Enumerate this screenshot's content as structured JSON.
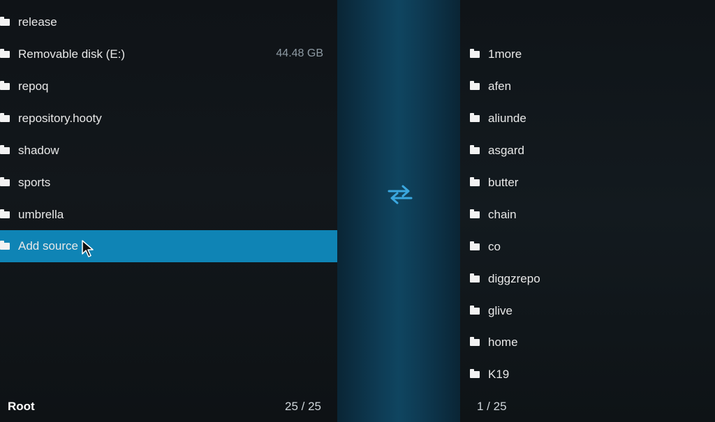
{
  "left_list": {
    "items": [
      {
        "label": "release"
      },
      {
        "label": "Removable disk (E:)",
        "size": "44.48 GB"
      },
      {
        "label": "repoq"
      },
      {
        "label": "repository.hooty"
      },
      {
        "label": "shadow"
      },
      {
        "label": "sports"
      },
      {
        "label": "umbrella"
      },
      {
        "label": "Add source",
        "selected": true
      }
    ]
  },
  "right_list": {
    "items": [
      {
        "label": "1more"
      },
      {
        "label": "afen"
      },
      {
        "label": "aliunde"
      },
      {
        "label": "asgard"
      },
      {
        "label": "butter"
      },
      {
        "label": "chain"
      },
      {
        "label": "co"
      },
      {
        "label": "diggzrepo"
      },
      {
        "label": "glive"
      },
      {
        "label": "home"
      },
      {
        "label": "K19"
      }
    ]
  },
  "footer": {
    "title": "Root",
    "left_count": "25 / 25",
    "right_count": "1 / 25"
  },
  "icons": {
    "folder": "folder-icon",
    "swap": "swap-arrows-icon",
    "cursor": "mouse-pointer-icon"
  },
  "colors": {
    "selection": "#0f84b5",
    "swap_icon": "#3aa7df",
    "background": "#101418"
  }
}
